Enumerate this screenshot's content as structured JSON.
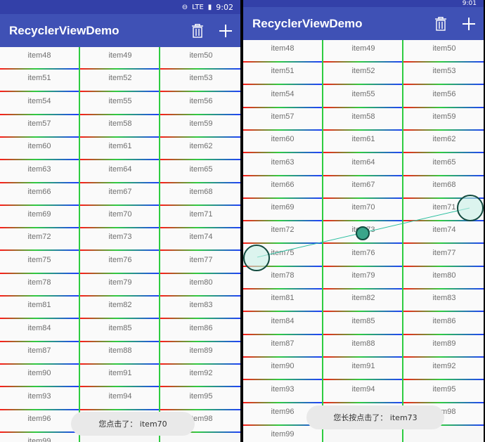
{
  "left_phone": {
    "status": {
      "time": "9:02",
      "signal": "LTE",
      "battery": "▮",
      "dnd": "⊖"
    },
    "appbar": {
      "title": "RecyclerViewDemo"
    },
    "first_item": 48,
    "last_item": 99,
    "toast": "您点击了：  item70"
  },
  "right_phone": {
    "status": {
      "time": "9:01",
      "signal": "LTE",
      "battery": "▮",
      "dnd": "⊖"
    },
    "appbar": {
      "title": "RecyclerViewDemo"
    },
    "first_item": 48,
    "last_item": 99,
    "toast": "您长按点击了：  item73",
    "pressed_item": "item73"
  },
  "icons": {
    "delete": "trash-icon",
    "add": "plus-icon"
  },
  "colors": {
    "appbar": "#3f51b5",
    "statusbar": "#3340a8",
    "divider_gradient": [
      "#ff1a1a",
      "#2ecc40",
      "#1f3cff"
    ],
    "toast_bg": "#e9e9e9",
    "touch_indicator": "#1a6b5a"
  }
}
